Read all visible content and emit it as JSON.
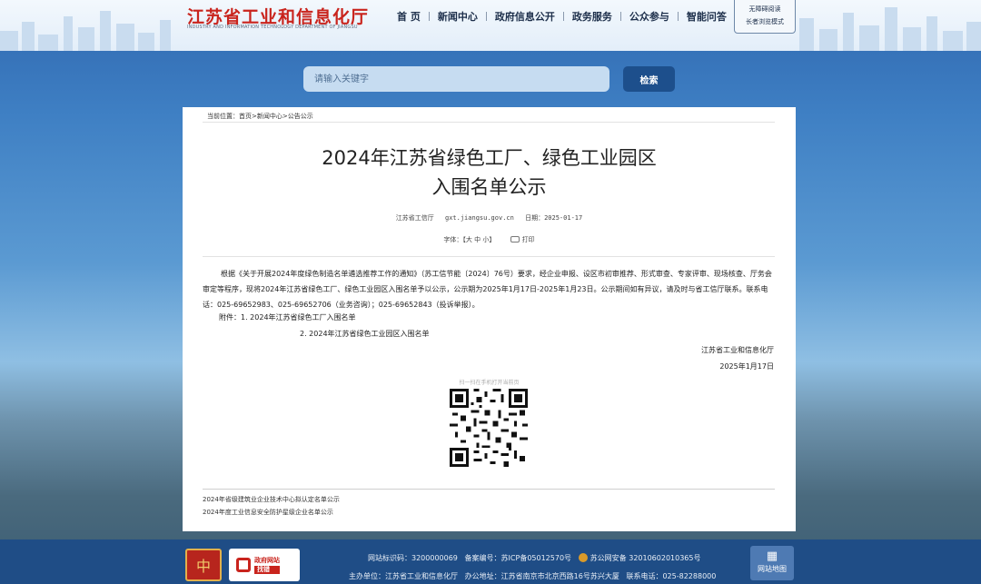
{
  "header": {
    "title": "江苏省工业和信息化厅",
    "subtitle": "INDUSTRY AND INFORMATION TECHNOLOGY DEPARTMENT OF JIANGSU",
    "nav": [
      "首 页",
      "新闻中心",
      "政府信息公开",
      "政务服务",
      "公众参与",
      "智能问答"
    ],
    "accessibility": [
      "无障碍阅读",
      "长者浏览模式"
    ]
  },
  "search": {
    "placeholder": "请输入关键字",
    "button": "检索"
  },
  "article": {
    "breadcrumb": "当前位置：首页>新闻中心>公告公示",
    "title_line1": "2024年江苏省绿色工厂、绿色工业园区",
    "title_line2": "入围名单公示",
    "source": "江苏省工信厅",
    "site": "gxt.jiangsu.gov.cn",
    "date": "日期：2025-01-17",
    "font_label": "字体：【大 中 小】",
    "print_label": "打印",
    "body": "根据《关于开展2024年度绿色制造名单遴选推荐工作的通知》（苏工信节能〔2024〕76号）要求，经企业申报、设区市初审推荐、形式审查、专家评审、现场核查、厅务会审定等程序，现将2024年江苏省绿色工厂、绿色工业园区入围名单予以公示，公示期为2025年1月17日-2025年1月23日。公示期间如有异议，请及时与省工信厅联系。联系电话：025-69652983、025-69652706（业务咨询）；025-69652843（投诉举报）。",
    "attachment1": "附件：1. 2024年江苏省绿色工厂入围名单",
    "attachment2": "2.    2024年江苏省绿色工业园区入围名单",
    "signer": "江苏省工业和信息化厅",
    "sign_date": "2025年1月17日",
    "qr_caption": "扫一扫在手机打开当前页",
    "related": [
      "2024年省级建筑业企业技术中心拟认定名单公示",
      "2024年度工业信息安全防护星级企业名单公示"
    ]
  },
  "footer": {
    "gov_badge": "中",
    "find_title": "政府网站",
    "find_sub": "找错",
    "line1_id": "网站标识码：3200000069",
    "line1_icp": "备案编号：苏ICP备05012570号",
    "line1_police": "苏公网安备 32010602010365号",
    "line2_host": "主办单位：江苏省工业和信息化厅",
    "line2_addr": "办公地址：江苏省南京市北京西路16号苏兴大厦",
    "line2_tel": "联系电话：025-82288000",
    "sitemap": "网站地图"
  },
  "colors": {
    "brand_red": "#c9241d",
    "nav_blue": "#1d4f8c",
    "footer_blue": "#1f4d86"
  }
}
